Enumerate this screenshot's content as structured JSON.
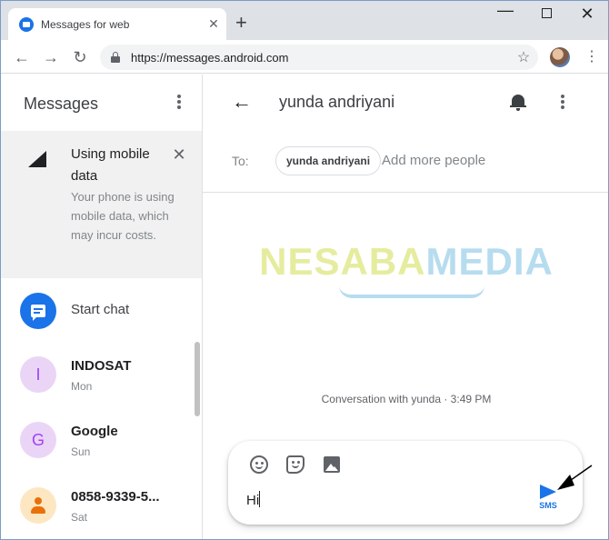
{
  "browser": {
    "tab_title": "Messages for web",
    "url": "https://messages.android.com"
  },
  "sidebar": {
    "title": "Messages",
    "banner": {
      "title": "Using mobile data",
      "body": "Your phone is using mobile data, which may incur costs."
    },
    "start_chat_label": "Start chat",
    "conversations": [
      {
        "avatar_letter": "I",
        "name": "INDOSAT",
        "time": "Mon"
      },
      {
        "avatar_letter": "G",
        "name": "Google",
        "time": "Sun"
      },
      {
        "avatar_letter": "",
        "name": "0858-9339-5...",
        "time": "Sat"
      }
    ]
  },
  "conversation": {
    "title": "yunda andriyani",
    "to_label": "To:",
    "recipient_chip": "yunda andriyani",
    "add_more_placeholder": "Add more people",
    "timestamp_note": "Conversation with yunda · 3:49 PM"
  },
  "watermark": {
    "part1": "NESABA",
    "part2": "MEDIA"
  },
  "compose": {
    "message_text": "Hi",
    "send_label": "SMS"
  },
  "colors": {
    "accent": "#1a73e8",
    "banner_bg": "#f1f1f1",
    "avatar_purple": "#ead5f7",
    "avatar_orange": "#fde7c2"
  }
}
